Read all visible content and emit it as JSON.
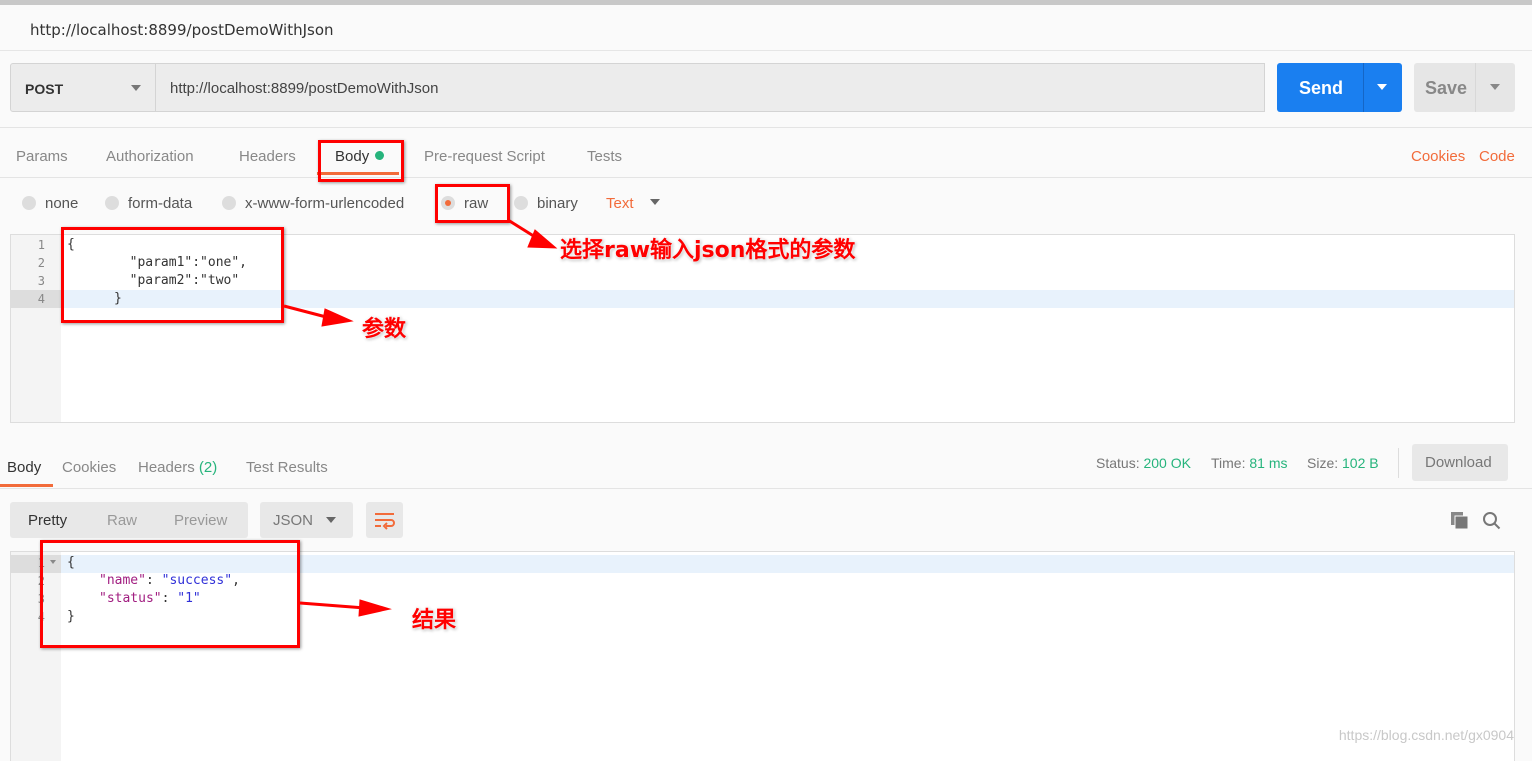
{
  "window": {
    "title": "http://localhost:8899/postDemoWithJson"
  },
  "request": {
    "method": "POST",
    "url": "http://localhost:8899/postDemoWithJson",
    "send_label": "Send",
    "save_label": "Save"
  },
  "request_tabs": [
    {
      "label": "Params"
    },
    {
      "label": "Authorization"
    },
    {
      "label": "Headers"
    },
    {
      "label": "Body",
      "active": true
    },
    {
      "label": "Pre-request Script"
    },
    {
      "label": "Tests"
    }
  ],
  "request_links": {
    "cookies": "Cookies",
    "code": "Code"
  },
  "body_types": [
    {
      "label": "none"
    },
    {
      "label": "form-data"
    },
    {
      "label": "x-www-form-urlencoded"
    },
    {
      "label": "raw",
      "selected": true
    },
    {
      "label": "binary"
    }
  ],
  "raw_type": "Text",
  "request_body": {
    "line_numbers": [
      "1",
      "2",
      "3",
      "4"
    ],
    "lines": [
      "{",
      "        \"param1\":\"one\",",
      "        \"param2\":\"two\"",
      "      }"
    ]
  },
  "response_tabs": [
    {
      "label": "Body",
      "active": true
    },
    {
      "label": "Cookies"
    },
    {
      "label": "Headers ",
      "count": "(2)"
    },
    {
      "label": "Test Results"
    }
  ],
  "response_meta": {
    "status_label": "Status:",
    "status": "200 OK",
    "time_label": "Time:",
    "time": "81 ms",
    "size_label": "Size:",
    "size": "102 B",
    "download_label": "Download"
  },
  "view_modes": [
    "Pretty",
    "Raw",
    "Preview"
  ],
  "format": "JSON",
  "response_body": {
    "line_numbers": [
      "1",
      "2",
      "3",
      "4"
    ],
    "name_key": "\"name\"",
    "name_val": "\"success\"",
    "status_key": "\"status\"",
    "status_val": "\"1\""
  },
  "annotations": {
    "raw_note": "选择raw输入json格式的参数",
    "params_note": "参数",
    "result_note": "结果"
  },
  "watermark": "https://blog.csdn.net/gx0904",
  "colors": {
    "accent": "#f26b3a",
    "send": "#1a7ff0",
    "success": "#26b47c",
    "annotation": "#ff0000"
  }
}
